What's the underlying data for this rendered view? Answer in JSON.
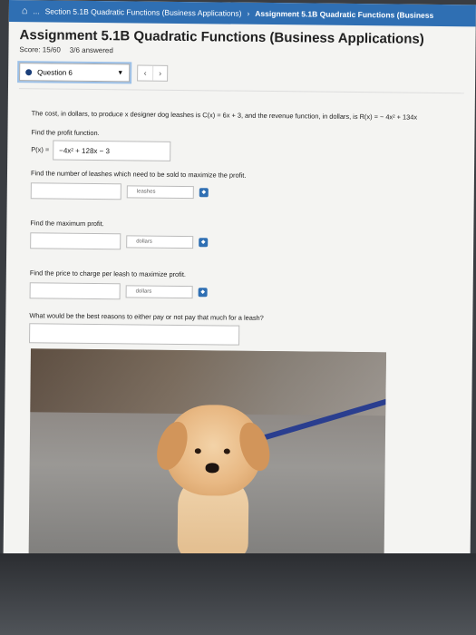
{
  "breadcrumb": {
    "ellipsis": "...",
    "section": "Section 5.1B Quadratic Functions (Business Applications)",
    "assignment": "Assignment 5.1B Quadratic Functions (Business"
  },
  "header": {
    "title": "Assignment 5.1B Quadratic Functions (Business Applications)",
    "score": "Score: 15/60",
    "answered": "3/6 answered"
  },
  "question_nav": {
    "selected": "Question 6",
    "prev": "‹",
    "next": "›"
  },
  "problem": {
    "statement": "The cost, in dollars, to produce x designer dog leashes is C(x) = 6x + 3, and the revenue function, in dollars, is R(x) = − 4x² + 134x",
    "part1_prompt": "Find the profit function.",
    "part1_prefix": "P(x) =",
    "part1_answer": "−4x² + 128x − 3",
    "part2_prompt": "Find the number of leashes which need to be sold to maximize the profit.",
    "part2_unit": "leashes",
    "part3_prompt": "Find the maximum profit.",
    "part3_unit": "dollars",
    "part4_prompt": "Find the price to charge per leash to maximize profit.",
    "part4_unit": "dollars",
    "part5_prompt": "What would be the best reasons to either pay or not pay that much for a leash?"
  }
}
